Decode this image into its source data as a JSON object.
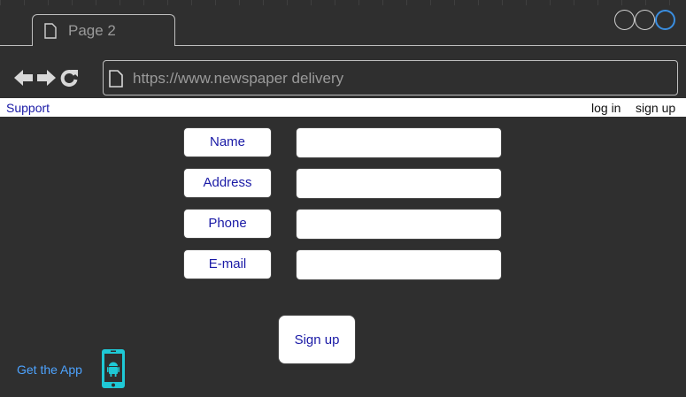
{
  "browser": {
    "tab_title": "Page 2",
    "url": "https://www.newspaper delivery"
  },
  "linkbar": {
    "support": "Support",
    "login": "log in",
    "signup": "sign up"
  },
  "form": {
    "fields": [
      {
        "label": "Name",
        "value": ""
      },
      {
        "label": "Address",
        "value": ""
      },
      {
        "label": "Phone",
        "value": ""
      },
      {
        "label": "E-mail",
        "value": ""
      }
    ],
    "submit_label": "Sign up"
  },
  "footer": {
    "get_app": "Get the App",
    "app_icon": "android-phone-icon"
  },
  "colors": {
    "background": "#2f2f2f",
    "link_blue": "#1a1aa6",
    "app_link": "#4da3ff",
    "phone_accent": "#1fc9d6"
  }
}
